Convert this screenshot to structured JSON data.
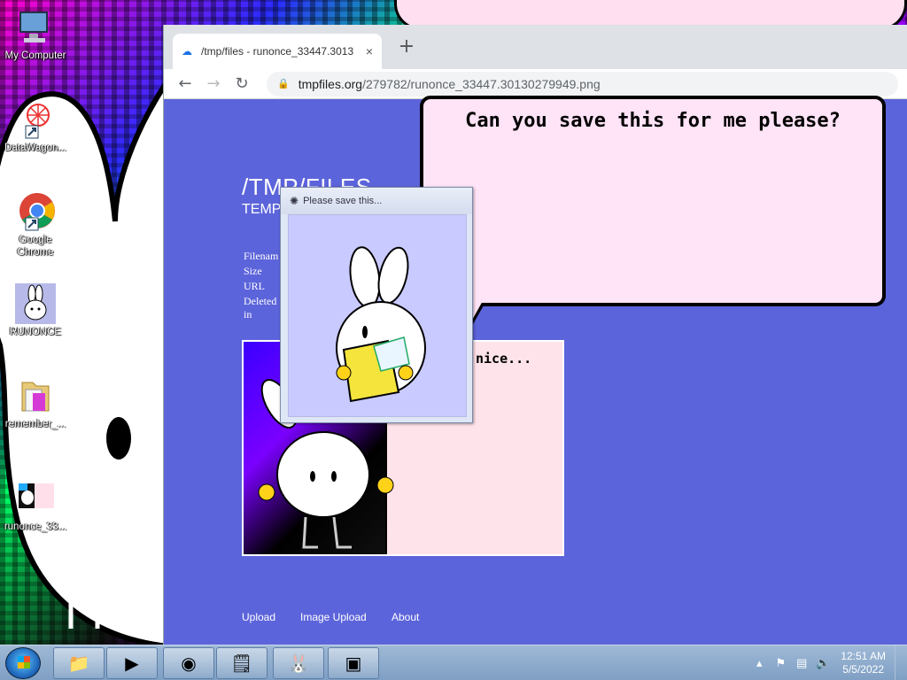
{
  "desktop": {
    "icons": [
      {
        "label": "My Computer",
        "icon": "computer-icon"
      },
      {
        "label": "DataWagon...",
        "icon": "datawagon-icon"
      },
      {
        "label": "Google Chrome",
        "icon": "chrome-icon"
      },
      {
        "label": "RUNONCE",
        "icon": "bunny-icon"
      },
      {
        "label": "remember_...",
        "icon": "folder-icon"
      },
      {
        "label": "runonce_33...",
        "icon": "image-file-icon"
      }
    ]
  },
  "browser": {
    "tab_title": "/tmp/files - runonce_33447.3013",
    "tab_close": "×",
    "new_tab": "+",
    "back": "←",
    "forward": "→",
    "reload": "↻",
    "url_host": "tmpfiles.org",
    "url_path": "/279782/runonce_33447.30130279949.png"
  },
  "page": {
    "title": "/TMP/FILES",
    "subtitle": "TEMP",
    "meta_labels": [
      "Filenam",
      "Size",
      "URL",
      "Deleted",
      "in"
    ],
    "preview_text": "nice...",
    "footer_links": [
      "Upload",
      "Image Upload",
      "About"
    ]
  },
  "bubble": {
    "text": "Can you save this for me please?"
  },
  "dialog": {
    "title": "Please save this..."
  },
  "taskbar": {
    "apps": [
      "explorer",
      "media-player",
      "chrome",
      "notepad",
      "bunny",
      "terminal"
    ],
    "time": "12:51 AM",
    "date": "5/5/2022"
  },
  "colors": {
    "page_bg": "#5c64db",
    "bubble_bg": "#ffe3f6",
    "dialog_body": "#c9caff"
  }
}
